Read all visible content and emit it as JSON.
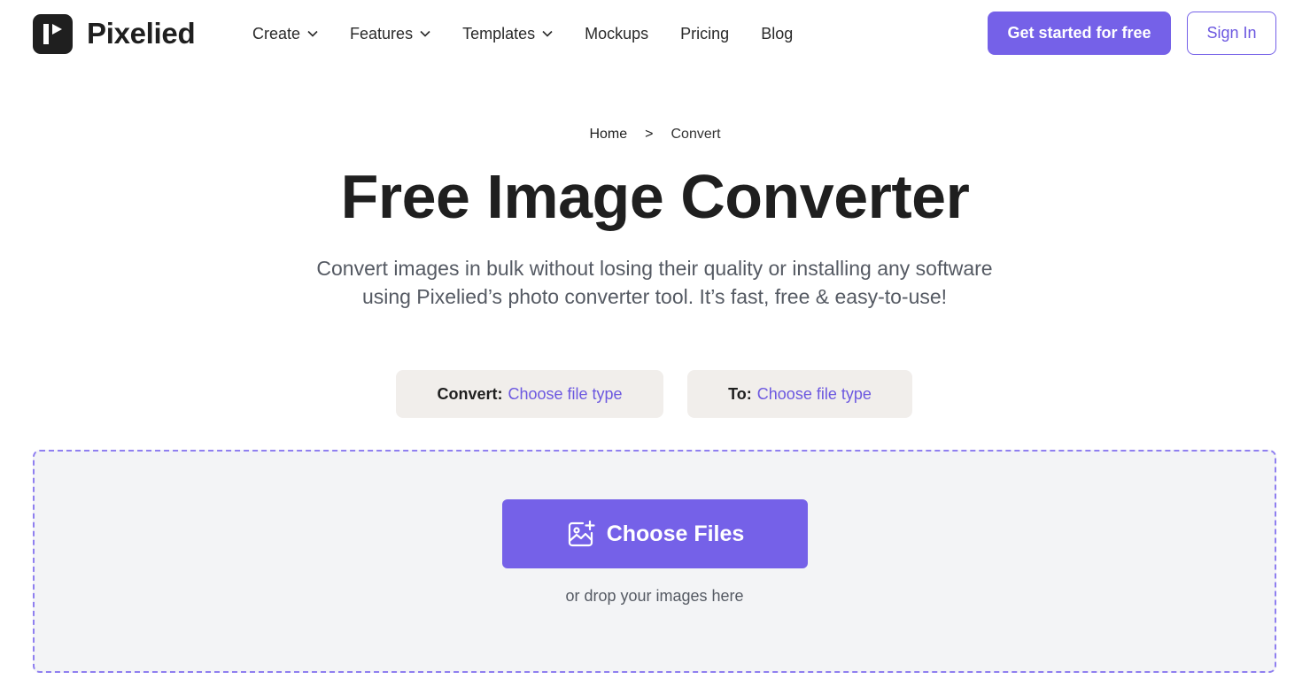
{
  "header": {
    "logo_text": "Pixelied",
    "nav": [
      {
        "label": "Create",
        "has_dropdown": true
      },
      {
        "label": "Features",
        "has_dropdown": true
      },
      {
        "label": "Templates",
        "has_dropdown": true
      },
      {
        "label": "Mockups",
        "has_dropdown": false
      },
      {
        "label": "Pricing",
        "has_dropdown": false
      },
      {
        "label": "Blog",
        "has_dropdown": false
      }
    ],
    "cta_label": "Get started for free",
    "signin_label": "Sign In"
  },
  "breadcrumb": {
    "home": "Home",
    "separator": ">",
    "current": "Convert"
  },
  "hero": {
    "title": "Free Image Converter",
    "subtitle": "Convert images in bulk without losing their quality or installing any software using Pixelied’s photo converter tool. It’s fast, free & easy-to-use!"
  },
  "converter": {
    "from_label": "Convert:",
    "from_value": "Choose file type",
    "to_label": "To:",
    "to_value": "Choose file type"
  },
  "dropzone": {
    "button_label": "Choose Files",
    "hint": "or drop your images here"
  },
  "colors": {
    "accent": "#7561e8",
    "link": "#6c58e0",
    "dark": "#1f1f1f",
    "select_bg": "#f1eeeb",
    "dropzone_bg": "#f3f4f6"
  },
  "icons": {
    "logo": "pixelied-logo-icon",
    "dropdown": "chevron-down-icon",
    "upload": "image-plus-icon"
  }
}
